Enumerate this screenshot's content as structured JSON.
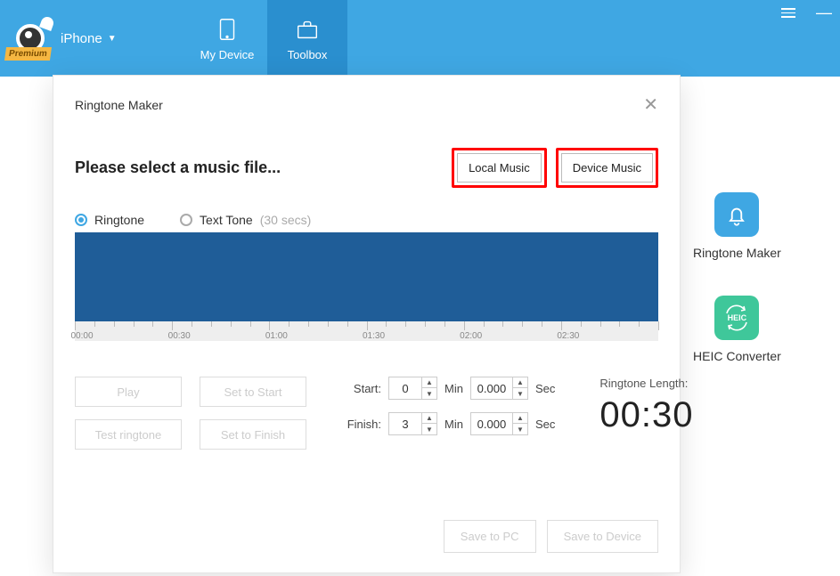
{
  "topbar": {
    "device_label": "iPhone",
    "premium_badge": "Premium",
    "tabs": {
      "my_device": "My Device",
      "toolbox": "Toolbox"
    }
  },
  "side": {
    "ringtone_maker": "Ringtone Maker",
    "heic_converter": "HEIC Converter",
    "heic_badge": "HEIC"
  },
  "dialog": {
    "title": "Ringtone Maker",
    "heading": "Please select a music file...",
    "local_music": "Local Music",
    "device_music": "Device Music",
    "radio_ringtone": "Ringtone",
    "radio_texttone": "Text Tone",
    "texttone_hint": "(30 secs)",
    "ruler_labels": [
      "00:00",
      "00:30",
      "01:00",
      "01:30",
      "02:00",
      "02:30"
    ],
    "buttons": {
      "play": "Play",
      "set_start": "Set to Start",
      "test": "Test ringtone",
      "set_finish": "Set to Finish",
      "save_pc": "Save to PC",
      "save_device": "Save to Device"
    },
    "time": {
      "start_label": "Start:",
      "finish_label": "Finish:",
      "min_label": "Min",
      "sec_label": "Sec",
      "start_min": "0",
      "start_sec": "0.000",
      "finish_min": "3",
      "finish_sec": "0.000"
    },
    "length": {
      "label": "Ringtone Length:",
      "value": "00:30"
    }
  }
}
